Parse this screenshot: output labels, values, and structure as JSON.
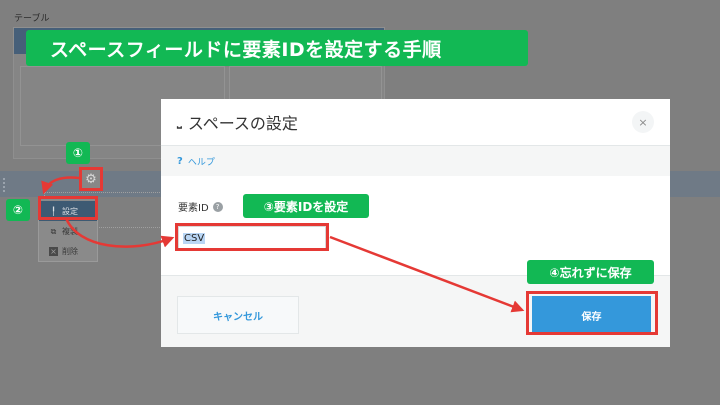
{
  "background": {
    "table_label": "テーブル",
    "menu": {
      "settings_label": "設定",
      "duplicate_label": "複製",
      "delete_label": "削除"
    }
  },
  "banner": {
    "text": "スペースフィールドに要素IDを設定する手順"
  },
  "dialog": {
    "title": "スペースの設定",
    "title_icon": "space-icon",
    "close_symbol": "×",
    "help_label": "ヘルプ",
    "element_id_label": "要素ID",
    "element_id_value": "CSV",
    "cancel_label": "キャンセル",
    "save_label": "保存"
  },
  "annotations": {
    "step1": "①",
    "step2": "②",
    "step3": "③要素IDを設定",
    "step4": "④忘れずに保存"
  },
  "colors": {
    "accent_green": "#12b854",
    "annotation_red": "#e53935",
    "primary_blue": "#3498db"
  }
}
